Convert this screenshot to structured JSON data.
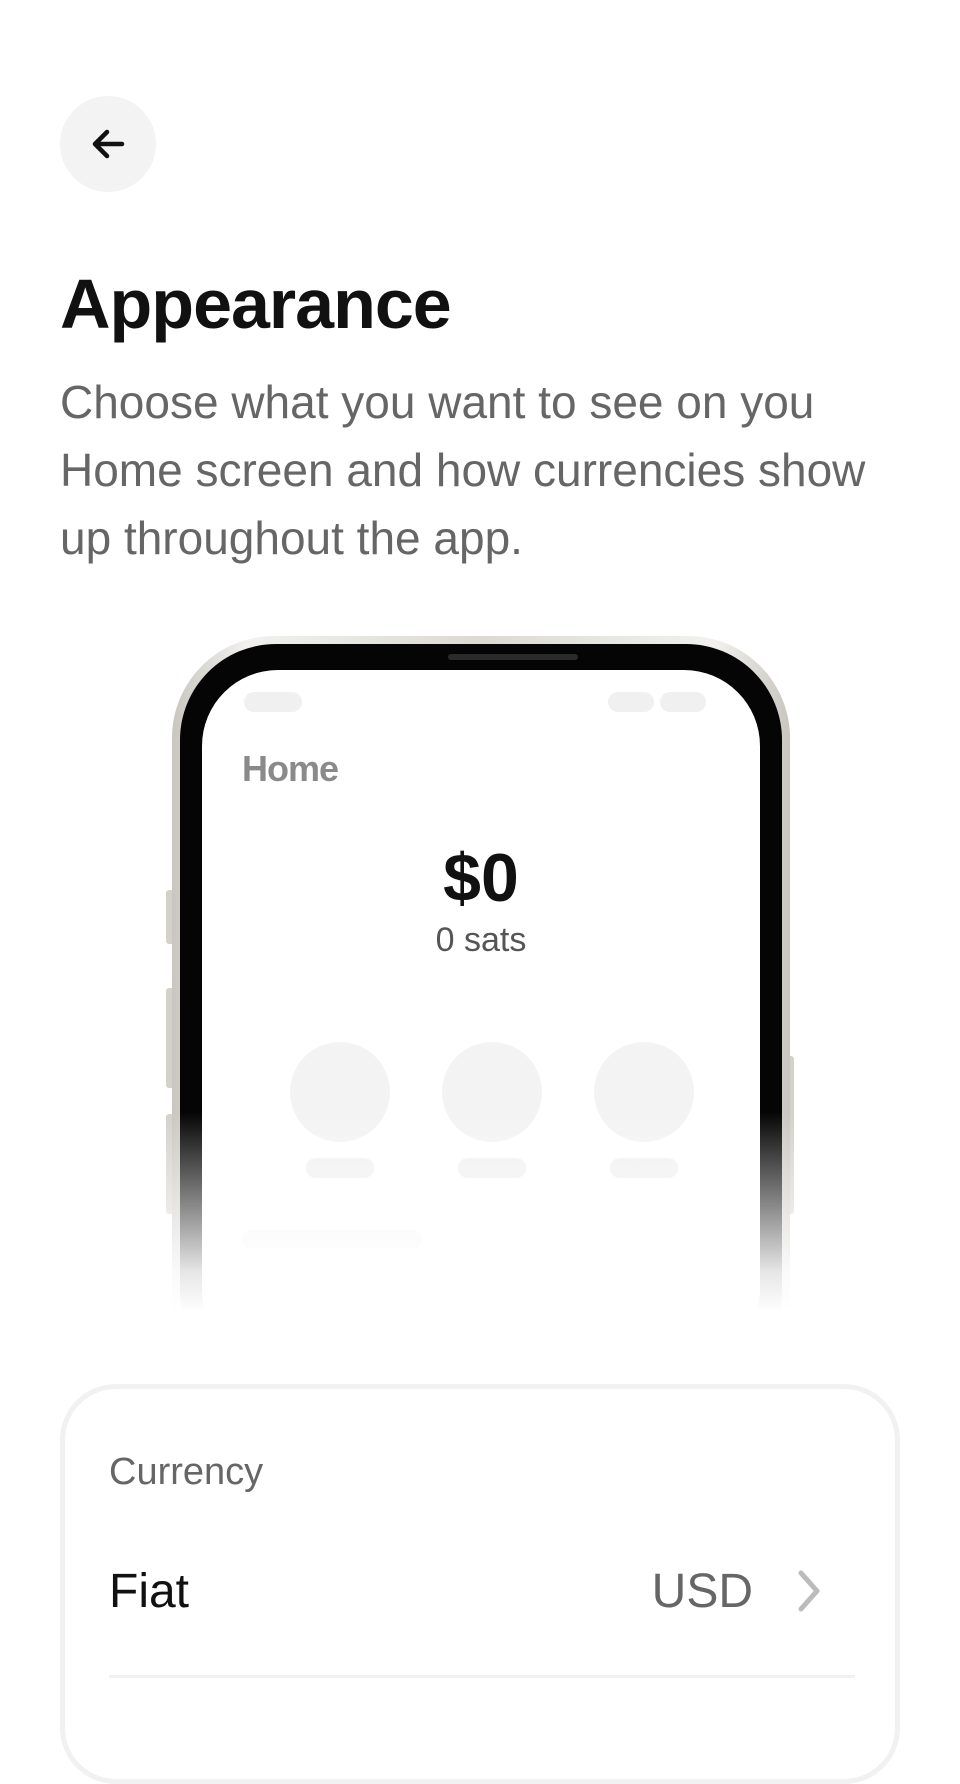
{
  "header": {
    "back_icon": "arrow-left-icon"
  },
  "page": {
    "title": "Appearance",
    "description": "Choose what you want to see on you Home screen and how currencies show up throughout the app."
  },
  "preview": {
    "screen_title": "Home",
    "balance": "$0",
    "balance_sats": "0 sats"
  },
  "settings": {
    "section_label": "Currency",
    "rows": [
      {
        "label": "Fiat",
        "value": "USD",
        "icon": "chevron-right-icon"
      }
    ]
  }
}
